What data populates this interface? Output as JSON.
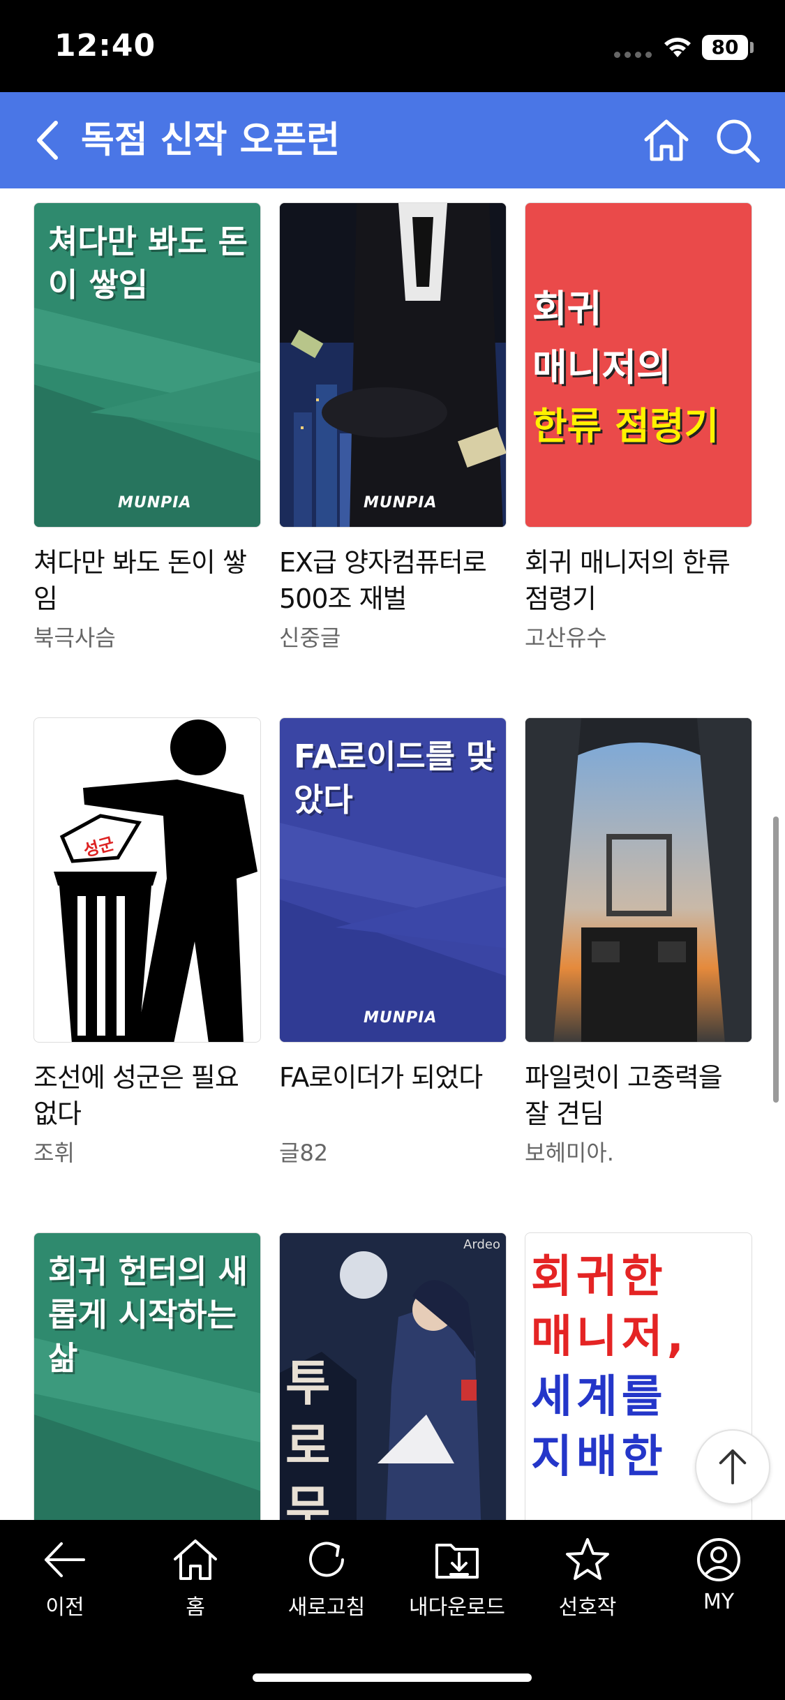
{
  "status_bar": {
    "time": "12:40",
    "battery": "80"
  },
  "header": {
    "title": "독점 신작 오픈런"
  },
  "books": [
    {
      "title": "쳐다만 봐도 돈이 쌓임",
      "author": "북극사슴",
      "cover_text": "쳐다만 봐도 돈이 쌓임",
      "cover_logo": "MUNPIA"
    },
    {
      "title": "EX급 양자컴퓨터로 500조 재벌",
      "author": "신중글",
      "cover_text": "",
      "cover_logo": "MUNPIA"
    },
    {
      "title": "회귀 매니저의 한류 점령기",
      "author": "고산유수",
      "cover_text_line1": "회귀",
      "cover_text_line2": "매니저의",
      "cover_text_line3": "한류 점령기"
    },
    {
      "title": "조선에 성군은 필요 없다",
      "author": "조휘",
      "cover_badge": "성군"
    },
    {
      "title": "FA로이더가 되었다",
      "author": "글82",
      "cover_text": "FA로이드를 맞았다",
      "cover_logo": "MUNPIA"
    },
    {
      "title": "파일럿이 고중력을 잘 견딤",
      "author": "보헤미아."
    },
    {
      "title": "",
      "author": "",
      "cover_text": "회귀 헌터의 새롭게 시작하는 삶"
    },
    {
      "title": "",
      "author": "",
      "cover_corner": "Ardeo",
      "cover_text": "투로무한"
    },
    {
      "title": "",
      "author": "",
      "cover_text_line1": "회귀한",
      "cover_text_line2": "매니저,",
      "cover_text_line3": "세계를",
      "cover_text_line4": "지배한"
    }
  ],
  "nav": {
    "back": "이전",
    "home": "홈",
    "refresh": "새로고침",
    "downloads": "내다운로드",
    "favorites": "선호작",
    "my": "MY"
  },
  "colors": {
    "header": "#4a76e6",
    "nav_bg": "#000000",
    "teal_cover": "#2f8a6e",
    "red_cover": "#ea4a4a",
    "blue_cover": "#3a45a4"
  }
}
